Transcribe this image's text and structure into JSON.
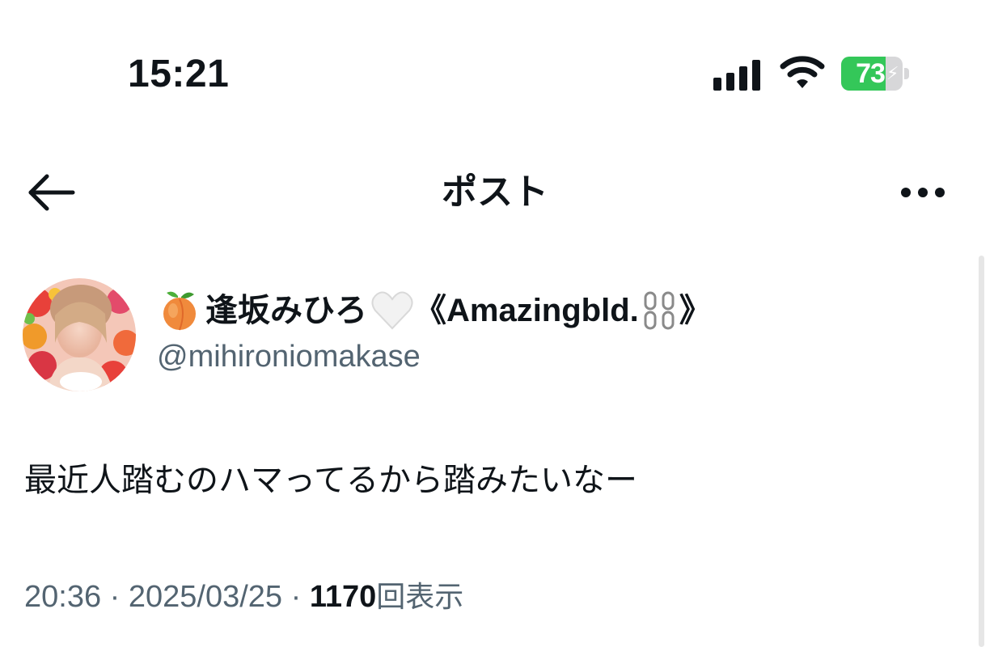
{
  "status_bar": {
    "time": "15:21",
    "battery_level": "73",
    "battery_percent": 73,
    "battery_color": "#34c759",
    "icons": [
      "cellular-signal-icon",
      "wifi-icon",
      "battery-charging-icon"
    ]
  },
  "header": {
    "title": "ポスト",
    "back_icon": "arrow-left-icon",
    "more_icon": "more-horizontal-icon"
  },
  "post": {
    "author": {
      "name_prefix_emoji": "peach-emoji",
      "name_jp": "逢坂みひろ",
      "name_heart_emoji": "white-heart-emoji",
      "name_en_open": "《Amazingbld.",
      "name_chain_emoji": "chain-emoji",
      "name_en_close": "》",
      "handle": "@mihironiomakase"
    },
    "text": "最近人踏むのハマってるから踏みたいなー",
    "time": "20:36",
    "separator": "·",
    "date": "2025/03/25",
    "views_count": "1170",
    "views_label": "回表示"
  },
  "colors": {
    "text_primary": "#0f1419",
    "text_secondary": "#536471"
  }
}
